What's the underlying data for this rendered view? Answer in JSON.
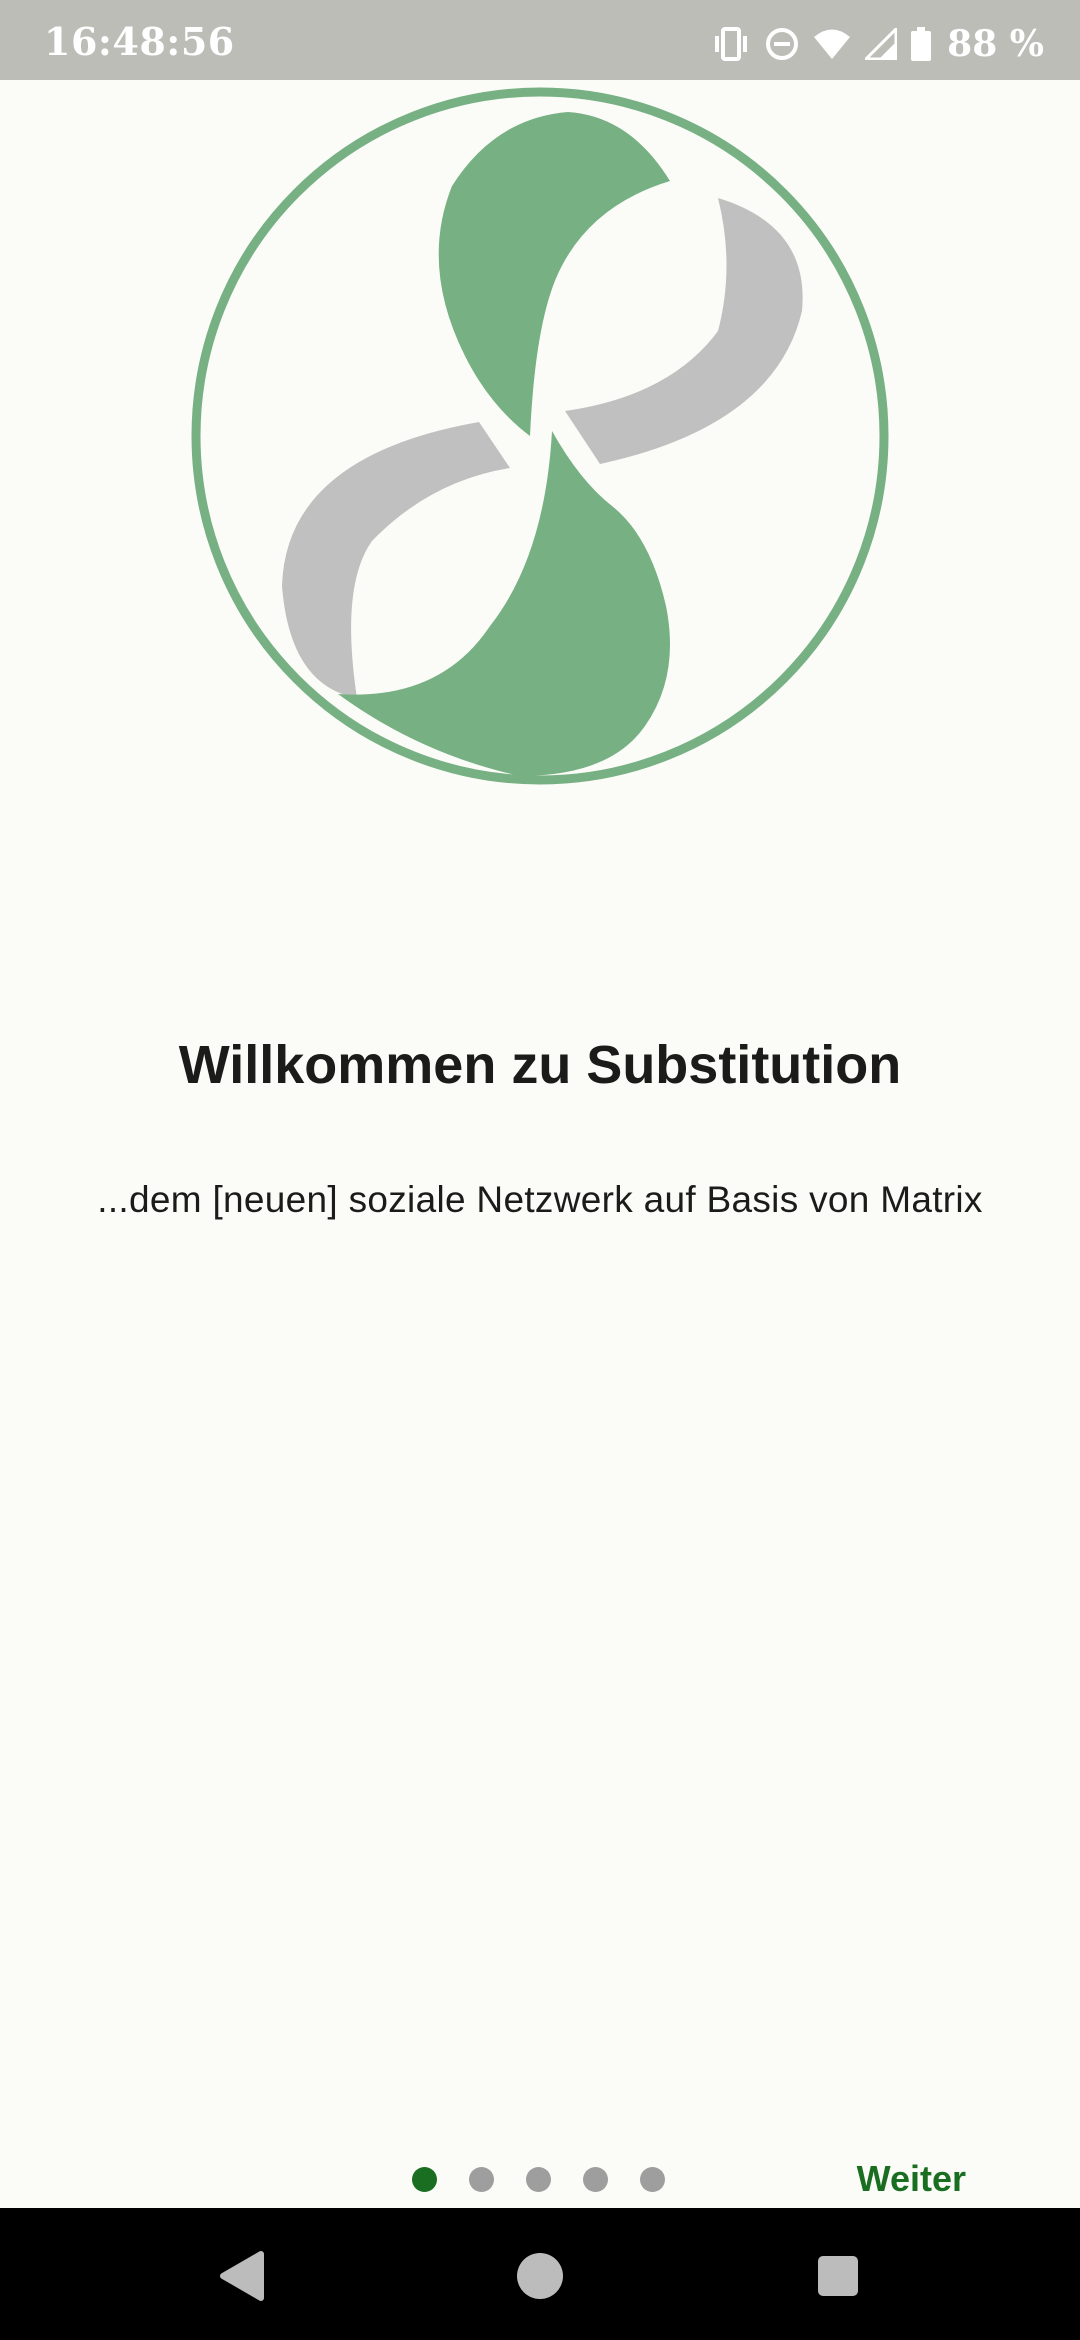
{
  "status_bar": {
    "time": "16:48:56",
    "battery_percent": "88 %",
    "icons": [
      "vibrate-icon",
      "do-not-disturb-icon",
      "wifi-icon",
      "signal-icon",
      "battery-icon"
    ]
  },
  "logo": {
    "name": "substitution-logo",
    "colors": {
      "green": "#77b083",
      "gray": "#c0c0c0"
    }
  },
  "onboarding": {
    "title": "Willkommen zu Substitution",
    "subtitle": "...dem [neuen] soziale Netzwerk auf Basis von Matrix",
    "page_count": 5,
    "current_page": 1,
    "next_label": "Weiter"
  },
  "nav_bar": {
    "buttons": [
      "back-icon",
      "home-icon",
      "recents-icon"
    ]
  },
  "colors": {
    "accent": "#1a6e22",
    "background": "#fbfcf7",
    "status_bar": "#bdbdb8",
    "dot_inactive": "#9e9e9e",
    "text": "#1b1c19"
  }
}
